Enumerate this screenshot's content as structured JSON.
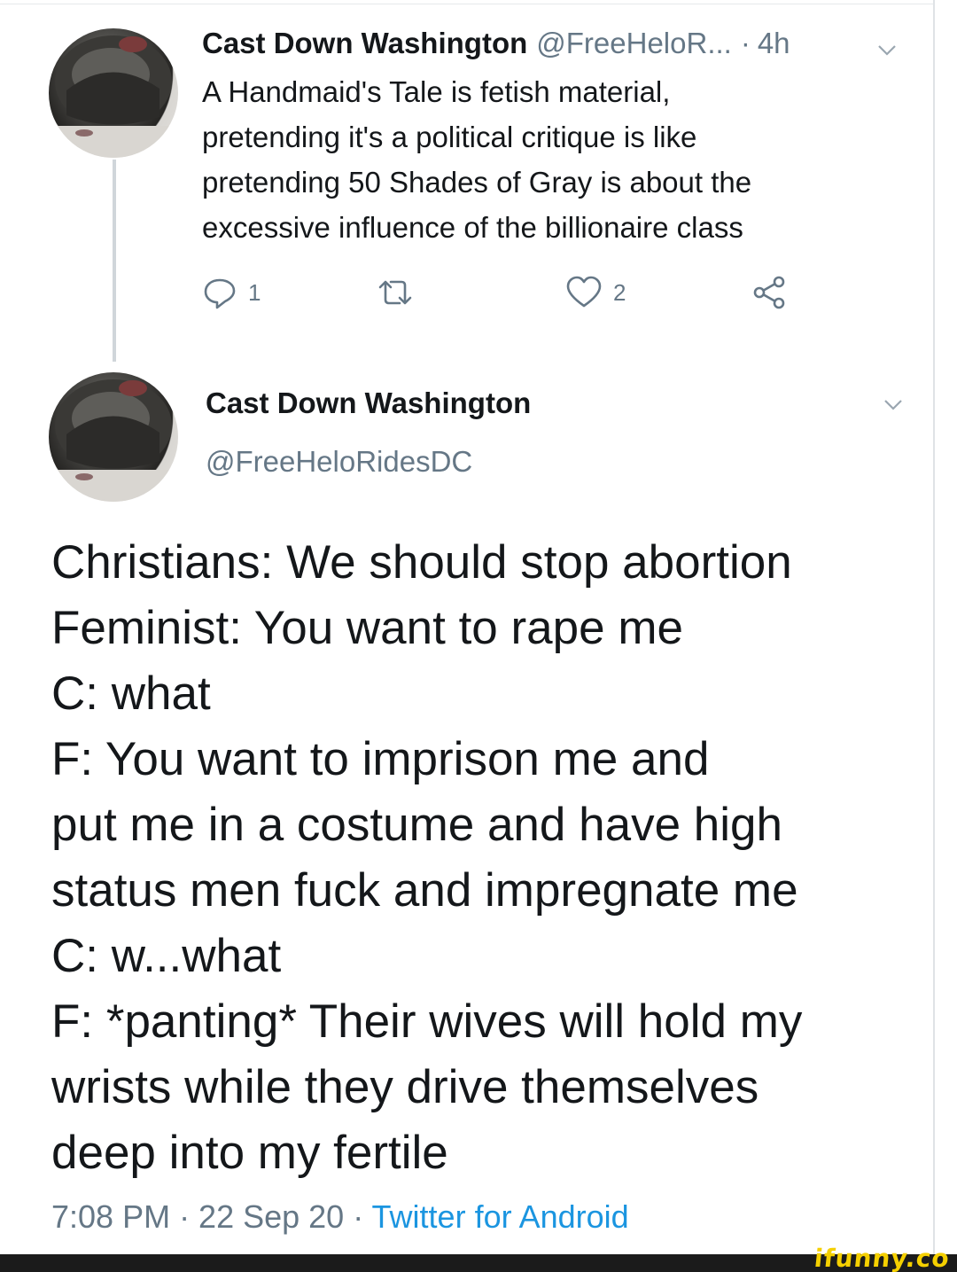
{
  "colors": {
    "text_primary": "#14171a",
    "text_secondary": "#657786",
    "link_blue": "#1b95e0",
    "ifunny_yellow": "#f5d000"
  },
  "first_tweet": {
    "author_name": "Cast Down Washington",
    "author_handle": "@FreeHeloR...",
    "separator": "·",
    "time_ago": "4h",
    "text_lines": [
      "A Handmaid's Tale is fetish material,",
      "pretending it's a political critique is like",
      "pretending 50 Shades of Gray is about the",
      "excessive influence of the billionaire class"
    ],
    "reply_count": "1",
    "retweet_count": "",
    "like_count": "2",
    "icons": {
      "reply": "reply-icon",
      "retweet": "retweet-icon",
      "like": "heart-icon",
      "share": "share-icon",
      "more": "chevron-down-icon"
    }
  },
  "main_tweet": {
    "author_name": "Cast Down Washington",
    "author_handle": "@FreeHeloRidesDC",
    "body_lines": [
      "Christians: We should stop abortion",
      "Feminist: You want to rape me",
      "C: what",
      "F: You want to imprison me and",
      "put me in a costume and have high",
      "status men fuck and impregnate me",
      "C: w...what",
      "F: *panting* Their wives will hold my",
      "wrists while they drive themselves",
      "deep into my fertile"
    ],
    "timestamp": "7:08 PM · 22 Sep 20 · ",
    "source": "Twitter for Android"
  },
  "watermark": {
    "text": "ifunny.co"
  }
}
